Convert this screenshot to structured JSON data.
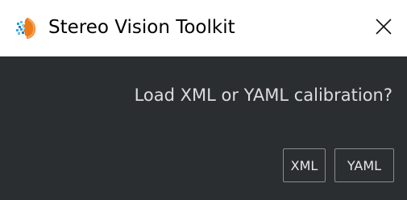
{
  "window": {
    "title": "Stereo Vision Toolkit",
    "icon": "stereo-vision-app-icon",
    "close_icon": "close-icon"
  },
  "dialog": {
    "message": "Load XML or YAML calibration?",
    "buttons": {
      "xml_label": "XML",
      "yaml_label": "YAML"
    }
  },
  "colors": {
    "titlebar_bg": "#ffffff",
    "client_bg": "#2b2e31",
    "text_light": "#dcdcdc",
    "button_border": "#8a8c8e"
  }
}
